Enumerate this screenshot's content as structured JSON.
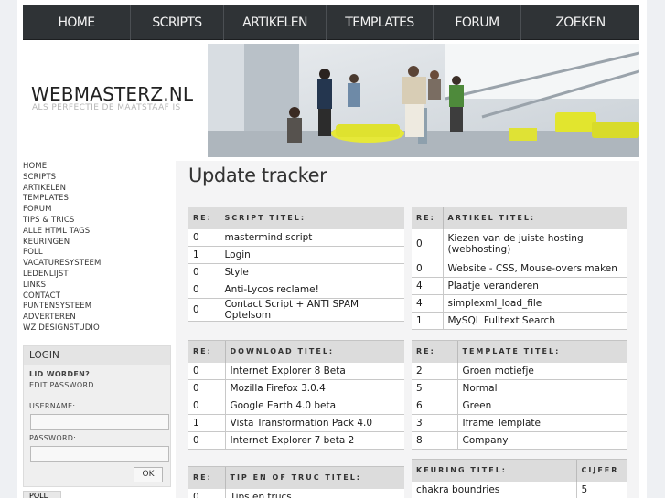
{
  "nav": [
    "HOME",
    "SCRIPTS",
    "ARTIKELEN",
    "TEMPLATES",
    "FORUM",
    "ZOEKEN"
  ],
  "logo": "WEBMASTERZ.NL",
  "tagline": "ALS PERFECTIE DE MAATSTAAF IS",
  "sidebar": [
    "HOME",
    "SCRIPTS",
    "ARTIKELEN",
    "TEMPLATES",
    "FORUM",
    "TIPS & TRICS",
    "ALLE HTML TAGS",
    "KEURINGEN",
    "POLL",
    "VACATURESYSTEEM",
    "LEDENLIJST",
    "LINKS",
    "CONTACT",
    "PUNTENSYSTEEM",
    "ADVERTEREN",
    "WZ DESIGNSTUDIO"
  ],
  "login": {
    "title": "LOGIN",
    "register": "LID WORDEN?",
    "edit_password": "EDIT PASSWORD",
    "username_label": "USERNAME:",
    "password_label": "PASSWORD:",
    "ok": "OK"
  },
  "poll_label": "POLL",
  "page_title": "Update tracker",
  "scripts": {
    "headers": [
      "RE:",
      "SCRIPT TITEL:"
    ],
    "rows": [
      [
        "0",
        "mastermind script"
      ],
      [
        "1",
        "Login"
      ],
      [
        "0",
        "Style"
      ],
      [
        "0",
        "Anti-Lycos reclame!"
      ],
      [
        "0",
        "Contact Script + ANTI SPAM Optelsom"
      ]
    ]
  },
  "artikels": {
    "headers": [
      "RE:",
      "ARTIKEL TITEL:"
    ],
    "rows": [
      [
        "0",
        "Kiezen van de juiste hosting (webhosting)"
      ],
      [
        "0",
        "Website - CSS, Mouse-overs maken"
      ],
      [
        "4",
        "Plaatje veranderen"
      ],
      [
        "4",
        "simplexml_load_file"
      ],
      [
        "1",
        "MySQL Fulltext Search"
      ]
    ]
  },
  "downloads": {
    "headers": [
      "RE:",
      "DOWNLOAD TITEL:"
    ],
    "rows": [
      [
        "0",
        "Internet Explorer 8 Beta"
      ],
      [
        "0",
        "Mozilla Firefox 3.0.4"
      ],
      [
        "0",
        "Google Earth 4.0 beta"
      ],
      [
        "1",
        "Vista Transformation Pack 4.0"
      ],
      [
        "0",
        "Internet Explorer 7 beta 2"
      ]
    ]
  },
  "templates": {
    "headers": [
      "RE:",
      "TEMPLATE TITEL:"
    ],
    "rows": [
      [
        "2",
        "Groen motiefje"
      ],
      [
        "5",
        "Normal"
      ],
      [
        "6",
        "Green"
      ],
      [
        "3",
        "Iframe Template"
      ],
      [
        "8",
        "Company"
      ]
    ]
  },
  "tips": {
    "headers": [
      "RE:",
      "TIP EN OF TRUC TITEL:"
    ],
    "rows": [
      [
        "0",
        "Tips en trucs"
      ]
    ]
  },
  "keuring": {
    "headers": [
      "KEURING TITEL:",
      "CIJFER"
    ],
    "rows": [
      [
        "chakra boundries",
        "5"
      ]
    ]
  }
}
